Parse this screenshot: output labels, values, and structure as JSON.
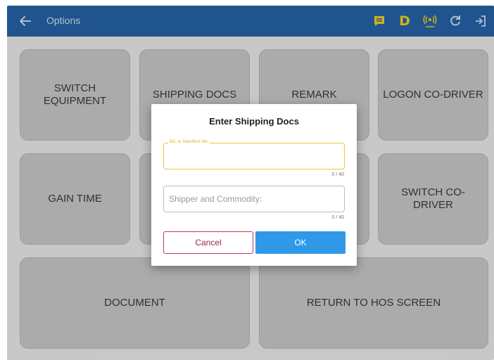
{
  "appbar": {
    "title": "Options",
    "status_letter": "D",
    "colors": {
      "bar": "#1f5fa5",
      "status_letter": "#f5d21b"
    },
    "icons": [
      "back-arrow-icon",
      "message-icon",
      "driver-status-icon",
      "signal-icon",
      "refresh-icon",
      "logout-icon"
    ]
  },
  "tiles": {
    "switch_equipment": "SWITCH EQUIPMENT",
    "shipping_docs": "SHIPPING DOCS",
    "remark": "REMARK",
    "logon_co_driver": "LOGON CO-DRIVER",
    "gain_time": "GAIN TIME",
    "switch_co_driver": "SWITCH CO-DRIVER",
    "document": "DOCUMENT",
    "return_hos": "RETURN TO HOS SCREEN"
  },
  "dialog": {
    "title": "Enter Shipping Docs",
    "bl_field": {
      "label": "B/L or Manifest No:",
      "value": "",
      "counter": "0 / 40"
    },
    "shipper_field": {
      "placeholder": "Shipper and Commodity:",
      "value": "",
      "counter": "0 / 40"
    },
    "cancel_label": "Cancel",
    "ok_label": "OK",
    "colors": {
      "focus": "#e8c83a",
      "cancel": "#c1365a",
      "ok": "#2f99e8"
    }
  }
}
